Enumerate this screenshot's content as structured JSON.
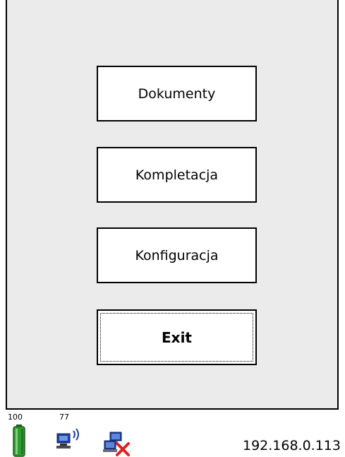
{
  "menu": {
    "documents_label": "Dokumenty",
    "picking_label": "Kompletacja",
    "configuration_label": "Konfiguracja",
    "exit_label": "Exit"
  },
  "statusbar": {
    "battery_level": "100",
    "signal_level": "77",
    "ip_address": "192.168.0.113",
    "icons": [
      "battery-icon",
      "wifi-signal-icon",
      "network-disconnected-icon"
    ]
  },
  "colors": {
    "window_background": "#ebebeb",
    "button_background": "#ffffff",
    "battery_green": "#2f9a2f",
    "network_blue": "#1e3f9e",
    "disconnect_red": "#e02020"
  }
}
